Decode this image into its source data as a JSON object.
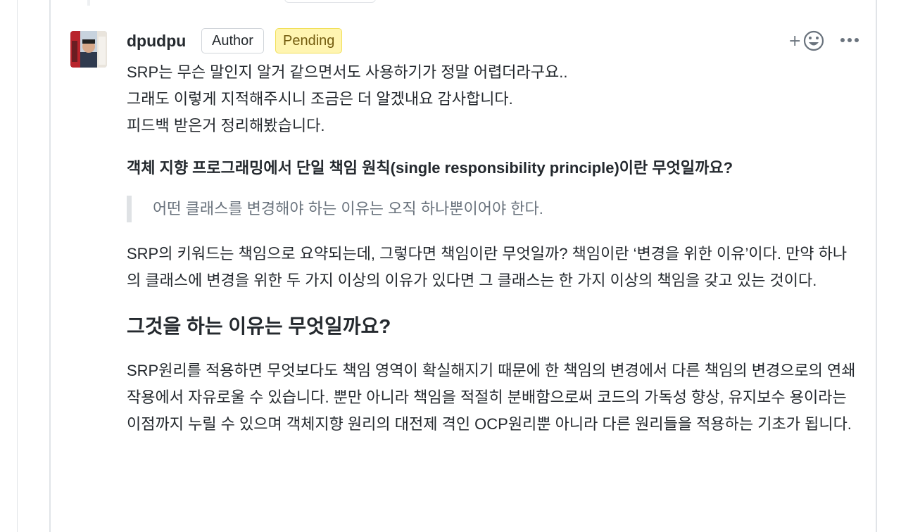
{
  "comment": {
    "author": "dpudpu",
    "badges": {
      "author": "Author",
      "pending": "Pending"
    },
    "reaction_plus": "+",
    "actions": {
      "add_reaction_icon": "smiley-icon",
      "more_icon": "kebab-horizontal-icon"
    },
    "body": {
      "intro_lines": [
        "SRP는 무슨 말인지 알거 같으면서도 사용하기가 정말 어렵더라구요..",
        "그래도 이렇게 지적해주시니 조금은 더 알겠내요 감사합니다.",
        "피드백 받은거 정리해봤습니다."
      ],
      "question": "객체 지향 프로그래밍에서 단일 책임 원칙(single responsibility principle)이란 무엇일까요?",
      "quote": "어떤 클래스를 변경해야 하는 이유는 오직 하나뿐이어야 한다.",
      "paragraph1": "SRP의 키워드는 책임으로 요약되는데, 그렇다면 책임이란 무엇일까? 책임이란 ‘변경을 위한 이유’이다. 만약 하나의 클래스에 변경을 위한 두 가지 이상의 이유가 있다면 그 클래스는 한 가지 이상의 책임을 갖고 있는 것이다.",
      "heading2": "그것을 하는 이유는 무엇일까요?",
      "paragraph2": "SRP원리를 적용하면 무엇보다도 책임 영역이 확실해지기 때문에 한 책임의 변경에서 다른 책임의 변경으로의 연쇄작용에서 자유로울 수 있습니다. 뿐만 아니라 책임을 적절히 분배함으로써 코드의 가독성 향상, 유지보수 용이라는 이점까지 누릴 수 있으며 객체지향 원리의 대전제 격인 OCP원리뿐 아니라 다른 원리들을 적용하는 기초가 됩니다."
    }
  },
  "colors": {
    "pending_bg": "#fff5b1",
    "pending_border": "#f1e05a",
    "quote_border": "#dfe2e5",
    "muted_text": "#6a737d"
  }
}
